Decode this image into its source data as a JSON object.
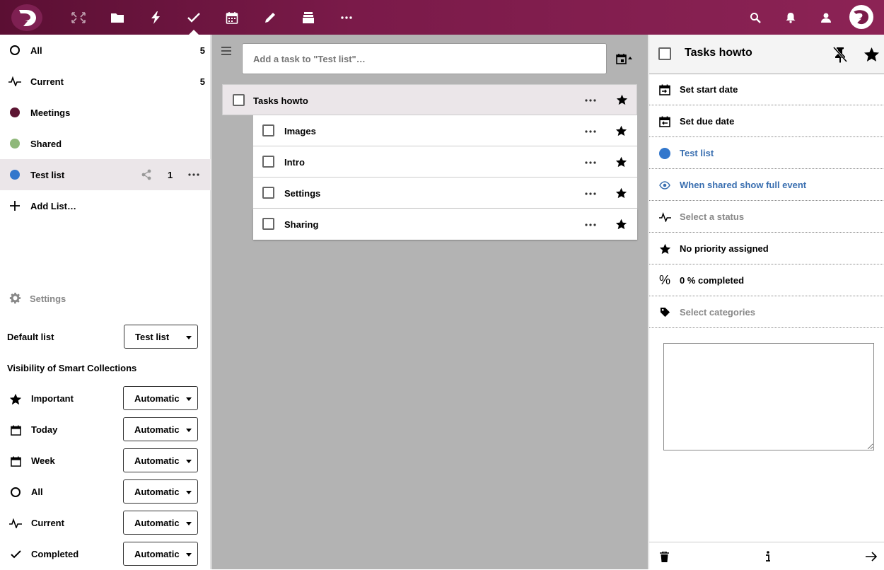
{
  "header": {
    "apps": [
      "dashboard-icon",
      "files-icon",
      "activity-icon",
      "tasks-icon",
      "calendar-icon",
      "notes-icon",
      "deck-icon",
      "more-apps-icon"
    ],
    "right_icons": [
      "search-icon",
      "notifications-icon",
      "contacts-icon",
      "user-avatar"
    ]
  },
  "sidebar": {
    "items": [
      {
        "label": "All",
        "count": "5",
        "icon": "circle-outline-icon"
      },
      {
        "label": "Current",
        "count": "5",
        "icon": "pulse-icon"
      },
      {
        "label": "Meetings",
        "color": "#5c1532",
        "icon": "color-dot"
      },
      {
        "label": "Shared",
        "color": "#8fb87a",
        "icon": "color-dot"
      },
      {
        "label": "Test list",
        "color": "#3377cc",
        "count": "1",
        "icon": "color-dot"
      },
      {
        "label": "Add List…",
        "icon": "plus-icon"
      }
    ],
    "settings_label": "Settings",
    "default_list_label": "Default list",
    "default_list_value": "Test list",
    "visibility_heading": "Visibility of Smart Collections",
    "collections": [
      {
        "label": "Important",
        "value": "Automatic",
        "icon": "star-icon"
      },
      {
        "label": "Today",
        "value": "Automatic",
        "icon": "calendar-icon"
      },
      {
        "label": "Week",
        "value": "Automatic",
        "icon": "calendar-icon"
      },
      {
        "label": "All",
        "value": "Automatic",
        "icon": "circle-outline-icon"
      },
      {
        "label": "Current",
        "value": "Automatic",
        "icon": "pulse-icon"
      },
      {
        "label": "Completed",
        "value": "Automatic",
        "icon": "check-icon"
      }
    ]
  },
  "main": {
    "add_task_placeholder": "Add a task to \"Test list\"…",
    "tasks": [
      {
        "title": "Tasks howto"
      },
      {
        "title": "Images"
      },
      {
        "title": "Intro"
      },
      {
        "title": "Settings"
      },
      {
        "title": "Sharing"
      }
    ]
  },
  "details": {
    "title": "Tasks howto",
    "props": [
      {
        "label": "Set start date",
        "icon": "calendar-start-icon"
      },
      {
        "label": "Set due date",
        "icon": "calendar-due-icon"
      },
      {
        "label": "Test list",
        "icon": "color-dot",
        "color": "#3377cc"
      },
      {
        "label": "When shared show full event",
        "icon": "eye-icon"
      },
      {
        "label": "Select a status",
        "icon": "pulse-icon"
      },
      {
        "label": "No priority assigned",
        "icon": "star-icon"
      },
      {
        "label": "0 % completed",
        "icon": "percent-icon"
      },
      {
        "label": "Select categories",
        "icon": "tag-icon"
      }
    ]
  },
  "colors": {
    "header": "#7a1a49",
    "link": "#3a6fb0",
    "muted": "#888888"
  }
}
